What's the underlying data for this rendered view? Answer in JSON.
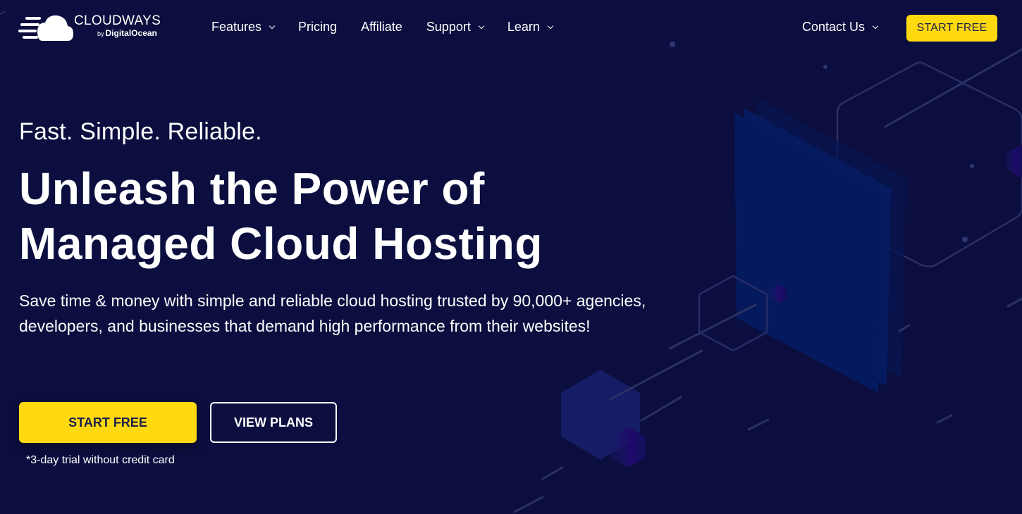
{
  "brand": {
    "name": "CLOUDWAYS",
    "by": "by",
    "parent": "DigitalOcean"
  },
  "nav": {
    "items": [
      {
        "label": "Features",
        "has_dropdown": true
      },
      {
        "label": "Pricing",
        "has_dropdown": false
      },
      {
        "label": "Affiliate",
        "has_dropdown": false
      },
      {
        "label": "Support",
        "has_dropdown": true
      },
      {
        "label": "Learn",
        "has_dropdown": true
      }
    ],
    "contact_label": "Contact Us",
    "start_free_label": "START FREE"
  },
  "hero": {
    "tagline": "Fast. Simple. Reliable.",
    "headline_line1": "Unleash the Power of",
    "headline_line2": "Managed Cloud Hosting",
    "description": "Save time & money with simple and reliable cloud hosting trusted by 90,000+ agencies, developers, and businesses that demand high performance from their websites!",
    "primary_cta": "START FREE",
    "secondary_cta": "VIEW PLANS",
    "trial_note": "*3-day trial without credit card"
  },
  "colors": {
    "background": "#0b0e3e",
    "accent_yellow": "#ffd90f",
    "button_text_dark": "#1b1f4b",
    "panel_blue": "#061a5e"
  }
}
